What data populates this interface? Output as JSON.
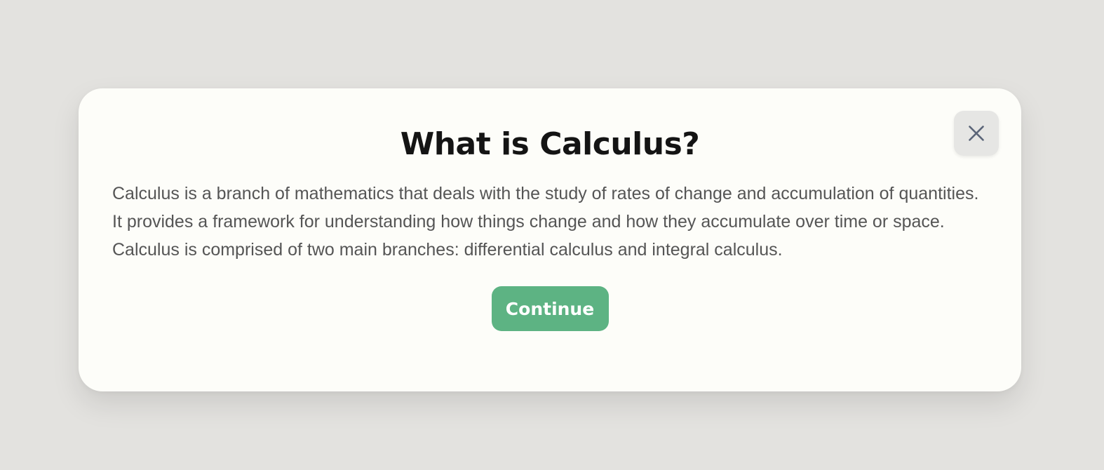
{
  "dialog": {
    "title": "What is Calculus?",
    "body": "Calculus is a branch of mathematics that deals with the study of rates of change and accumulation of quantities. It provides a framework for understanding how things change and how they accumulate over time or space. Calculus is comprised of two main branches: differential calculus and integral calculus.",
    "continue_label": "Continue",
    "close_icon": "close-icon"
  },
  "colors": {
    "backdrop": "#e3e2df",
    "dialog_background": "#fdfdf9",
    "title_text": "#141414",
    "body_text": "#555555",
    "primary_button": "#5db383",
    "close_button_background": "#e6e6e4",
    "close_icon": "#5b6578"
  }
}
